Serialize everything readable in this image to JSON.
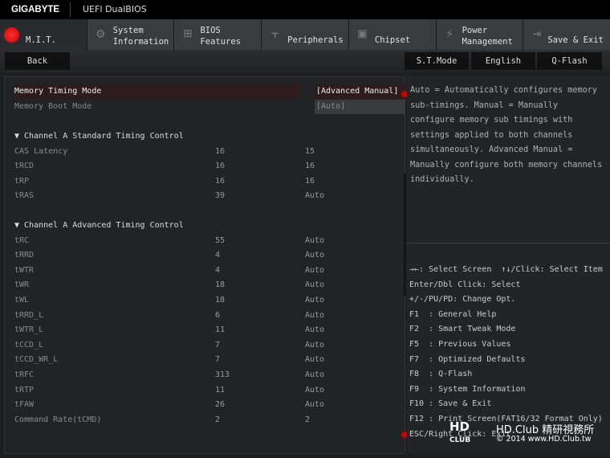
{
  "header": {
    "brand": "GIGABYTE",
    "title": "UEFI DualBIOS"
  },
  "tabs": [
    {
      "line1": "",
      "line2": "M.I.T.",
      "icon": "mit-red-dot-icon",
      "active": true
    },
    {
      "line1": "System",
      "line2": "Information",
      "icon": "gear-icon"
    },
    {
      "line1": "BIOS",
      "line2": "Features",
      "icon": "bios-chip-icon"
    },
    {
      "line1": "",
      "line2": "Peripherals",
      "icon": "peripherals-icon"
    },
    {
      "line1": "",
      "line2": "Chipset",
      "icon": "chipset-icon"
    },
    {
      "line1": "Power",
      "line2": "Management",
      "icon": "power-bolt-icon"
    },
    {
      "line1": "",
      "line2": "Save & Exit",
      "icon": "exit-door-icon"
    }
  ],
  "toolbar": {
    "back": "Back",
    "st_mode": "S.T.Mode",
    "language": "English",
    "qflash": "Q-Flash"
  },
  "settings": {
    "memory_timing_mode": {
      "label": "Memory Timing Mode",
      "value": "[Advanced Manual]"
    },
    "memory_boot_mode": {
      "label": "Memory Boot Mode",
      "value": "[Auto]"
    },
    "standard_header": "▼ Channel A Standard Timing Control",
    "standard": [
      {
        "name": "CAS Latency",
        "current": "16",
        "value": "15"
      },
      {
        "name": "tRCD",
        "current": "16",
        "value": "16"
      },
      {
        "name": "tRP",
        "current": "16",
        "value": "16"
      },
      {
        "name": "tRAS",
        "current": "39",
        "value": "Auto"
      }
    ],
    "advanced_header": "▼ Channel A Advanced Timing Control",
    "advanced": [
      {
        "name": "tRC",
        "current": "55",
        "value": "Auto"
      },
      {
        "name": "tRRD",
        "current": "4",
        "value": "Auto"
      },
      {
        "name": "tWTR",
        "current": "4",
        "value": "Auto"
      },
      {
        "name": "tWR",
        "current": "18",
        "value": "Auto"
      },
      {
        "name": "tWL",
        "current": "18",
        "value": "Auto"
      },
      {
        "name": "tRRD_L",
        "current": "6",
        "value": "Auto"
      },
      {
        "name": "tWTR_L",
        "current": "11",
        "value": "Auto"
      },
      {
        "name": "tCCD_L",
        "current": "7",
        "value": "Auto"
      },
      {
        "name": "tCCD_WR_L",
        "current": "7",
        "value": "Auto"
      },
      {
        "name": "tRFC",
        "current": "313",
        "value": "Auto"
      },
      {
        "name": "tRTP",
        "current": "11",
        "value": "Auto"
      },
      {
        "name": "tFAW",
        "current": "26",
        "value": "Auto"
      },
      {
        "name": "Command Rate(tCMD)",
        "current": "2",
        "value": "2"
      }
    ]
  },
  "help": {
    "text": "Auto = Automatically configures memory sub-timings. Manual = Manually configure memory sub timings with settings applied to both channels simultaneously. Advanced Manual = Manually configure both memory channels individually."
  },
  "keys": [
    "→←: Select Screen  ↑↓/Click: Select Item",
    "Enter/Dbl Click: Select",
    "+/-/PU/PD: Change Opt.",
    "F1  : General Help",
    "F2  : Smart Tweak Mode",
    "F5  : Previous Values",
    "F7  : Optimized Defaults",
    "F8  : Q-Flash",
    "F9  : System Information",
    "F10 : Save & Exit",
    "F12 : Print Screen(FAT16/32 Format Only)",
    "ESC/Right Click: Exit"
  ],
  "watermark": {
    "logo": "HD CLUB",
    "line1": "HD.Club 精研視務所",
    "line2": "© 2014  www.HD.Club.tw"
  }
}
